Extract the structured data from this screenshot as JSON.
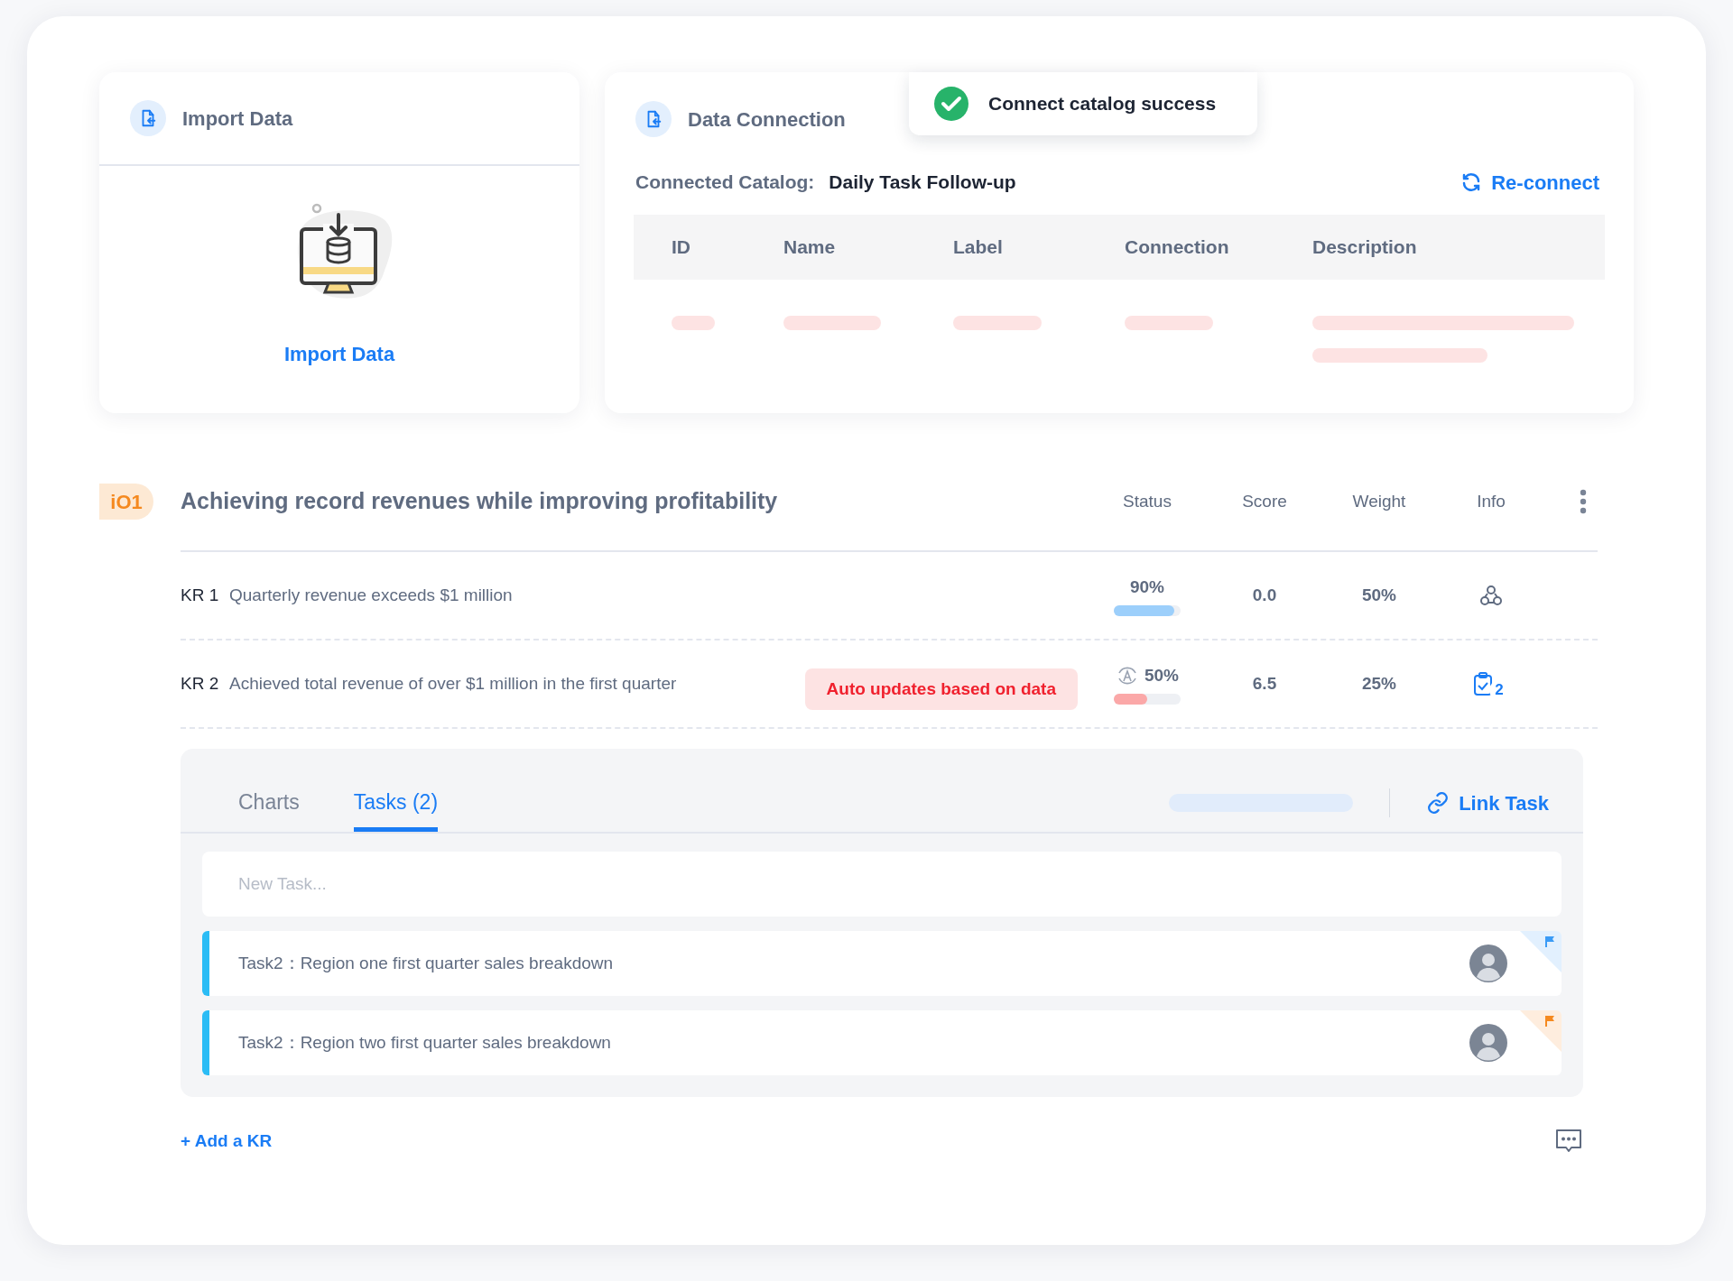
{
  "import_card": {
    "title": "Import Data",
    "action": "Import Data"
  },
  "connection_card": {
    "title": "Data Connection",
    "catalog_label": "Connected Catalog:",
    "catalog_value": "Daily Task Follow-up",
    "reconnect": "Re-connect",
    "columns": [
      "ID",
      "Name",
      "Label",
      "Connection",
      "Description"
    ]
  },
  "toast": {
    "kind": "success",
    "message": "Connect catalog success"
  },
  "objective": {
    "badge": "iO1",
    "title": "Achieving record revenues while improving profitability",
    "columns": [
      "Status",
      "Score",
      "Weight",
      "Info"
    ],
    "key_results": [
      {
        "label": "KR 1",
        "text": "Quarterly revenue exceeds $1 million",
        "auto_update": false,
        "percent": "90%",
        "level": 0.9,
        "color": "#9ccffb",
        "score": "0.0",
        "weight": "50%",
        "info": {
          "kind": "people"
        }
      },
      {
        "label": "KR 2",
        "text": "Achieved total revenue of over $1 million in the first quarter",
        "auto_update": true,
        "tooltip": "Auto updates based on data",
        "percent": "50%",
        "level": 0.5,
        "color": "#fba8a8",
        "score": "6.5",
        "weight": "25%",
        "info": {
          "kind": "tasks",
          "count": "2"
        }
      }
    ],
    "tabs": [
      {
        "label": "Charts",
        "selected": false
      },
      {
        "label": "Tasks (2)",
        "selected": true
      }
    ],
    "link_task": "Link Task",
    "new_task": {
      "placeholder": "New Task..."
    },
    "tasks": [
      {
        "text": "Task2：Region one first quarter sales breakdown",
        "color": "#3a9bf6"
      },
      {
        "text": "Task2：Region two first quarter sales breakdown",
        "color": "#f5891f"
      }
    ],
    "add_kr": "+ Add a KR"
  }
}
